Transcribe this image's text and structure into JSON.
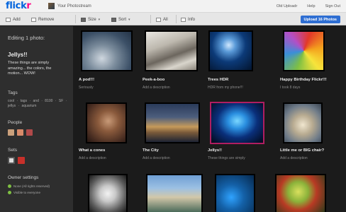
{
  "topbar": {
    "logo_main": "flick",
    "logo_r": "r",
    "photostream_label": "Your Photostream",
    "links": [
      "Old Uploadr",
      "Help",
      "Sign Out"
    ]
  },
  "toolbar": {
    "add": "Add",
    "remove": "Remove",
    "size": "Size",
    "sort": "Sort",
    "all": "All",
    "info": "Info",
    "upload": "Upload 16 Photos"
  },
  "sidebar": {
    "editing": "Editing 1 photo:",
    "title": "Jellys!!",
    "description": "These things are simply amazing... the colors, the motion... WOW!",
    "tags_heading": "Tags",
    "tags": "cool · tags · and · 8100 · SF · jellys · aquarium",
    "people_heading": "People",
    "sets_heading": "Sets",
    "owner_heading": "Owner settings",
    "owner_none": "None (All rights reserved)",
    "owner_visible": "Visible to everyone"
  },
  "photos": [
    {
      "title": "A pod!!!",
      "desc": "Seriously"
    },
    {
      "title": "Peek-a-boo",
      "desc": "Add a description"
    },
    {
      "title": "Trees HDR",
      "desc": "HDR from my phone!!!"
    },
    {
      "title": "Happy Birthday Flickr!!!",
      "desc": "I took 8 days"
    },
    {
      "title": "What a cones",
      "desc": "Add a description"
    },
    {
      "title": "The City",
      "desc": "Add a description"
    },
    {
      "title": "Jellys!!",
      "desc": "These things are simply"
    },
    {
      "title": "Little me or BIG chair?",
      "desc": "Add a description"
    }
  ],
  "colors": {
    "logo_blue": "#0063dc",
    "logo_pink": "#ff0084",
    "upload_button": "#2e6ed2",
    "selected_border": "#b01e61"
  }
}
